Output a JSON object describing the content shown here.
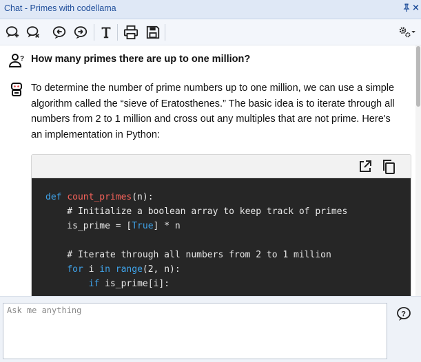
{
  "window": {
    "title": "Chat - Primes with codellama",
    "pin_glyph": "ⱼ",
    "close_glyph": "×"
  },
  "toolbar": {
    "buttons": [
      {
        "name": "new-chat-icon"
      },
      {
        "name": "clear-chat-icon"
      },
      {
        "name": "previous-icon"
      },
      {
        "name": "next-icon"
      },
      {
        "name": "text-format-icon",
        "label": "T"
      },
      {
        "name": "print-icon"
      },
      {
        "name": "save-icon"
      }
    ],
    "settings_icon": "settings-gear-icon"
  },
  "chat": {
    "question": "How many primes there are up to one million?",
    "answer_lines": [
      "To determine the number of prime numbers up to one million, we can use a simple",
      "algorithm called the “sieve of Eratosthenes.” The basic idea is to iterate through all",
      "numbers from 2 to 1 million and cross out any multiples that are not prime. Here's",
      "an implementation in Python:"
    ],
    "code": {
      "line1_kw": "def",
      "line1_fn": "count_primes",
      "line1_rest": "(n):",
      "line2": "    # Initialize a boolean array to keep track of primes",
      "line3_a": "    is_prime = [",
      "line3_b": "True",
      "line3_c": "] * n",
      "line5": "    # Iterate through all numbers from 2 to 1 million",
      "line6_kw1": "for",
      "line6_var": " i ",
      "line6_kw2": "in",
      "line6_kw3": "range",
      "line6_rest": "(2, n):",
      "line7_kw": "if",
      "line7_rest": " is_prime[i]:"
    }
  },
  "input": {
    "placeholder": "Ask me anything"
  },
  "colors": {
    "accent": "#1f4e9a",
    "code_bg": "#262626",
    "keyword": "#3fa2e8",
    "function": "#f4625a"
  }
}
